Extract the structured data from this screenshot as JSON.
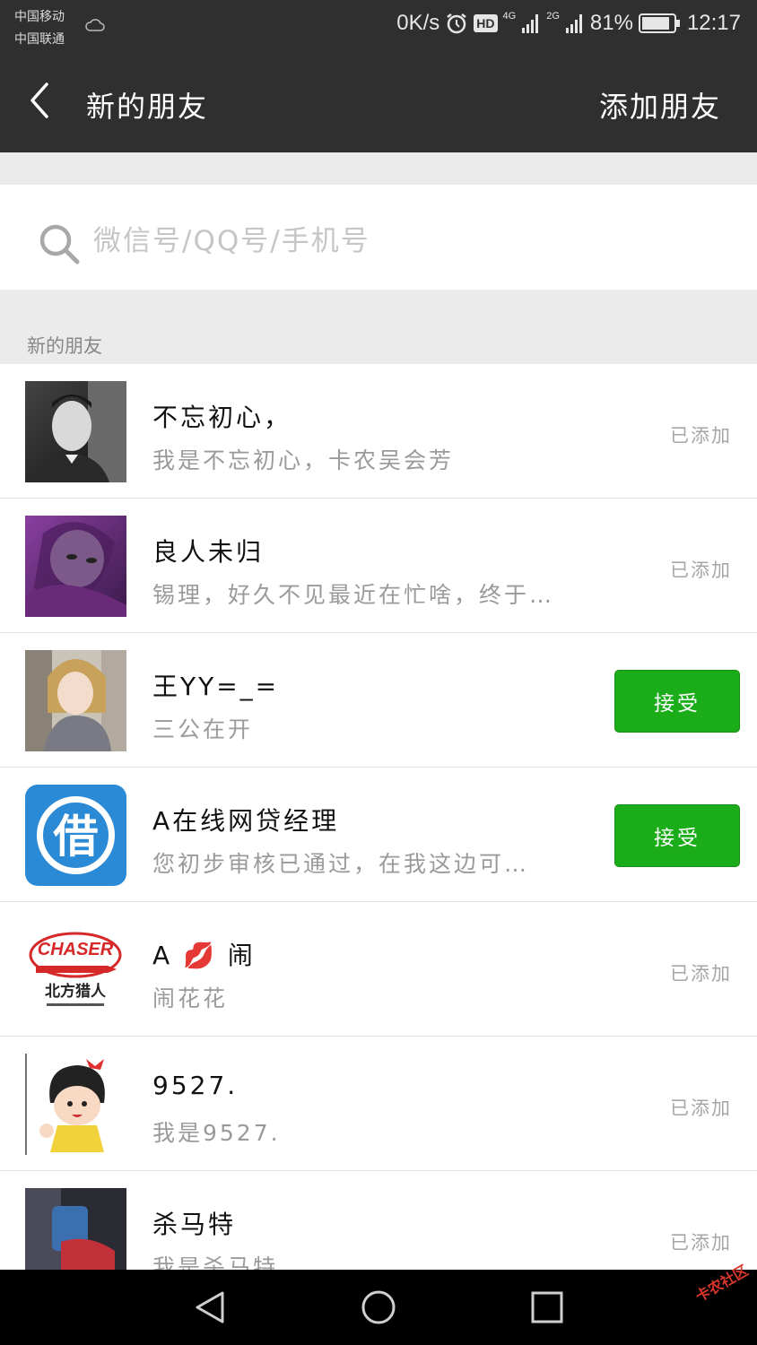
{
  "status_bar": {
    "carrier1": "中国移动",
    "carrier2": "中国联通",
    "speed": "0K/s",
    "hd": "HD",
    "net1": "4G",
    "net2": "2G",
    "battery": "81%",
    "time": "12:17"
  },
  "header": {
    "title": "新的朋友",
    "action": "添加朋友"
  },
  "search": {
    "placeholder": "微信号/QQ号/手机号"
  },
  "section_label": "新的朋友",
  "requests": [
    {
      "name": "不忘初心，",
      "message": "我是不忘初心，卡农吴会芳",
      "status": "已添加",
      "avatar": "avatar-man"
    },
    {
      "name": "良人未归",
      "message": "锡理，好久不见最近在忙啥，终于…",
      "status": "已添加",
      "avatar": "avatar-girl-purple"
    },
    {
      "name": "王YY=_=",
      "message": "三公在开",
      "status": "接受",
      "avatar": "avatar-girl-photo"
    },
    {
      "name": "A在线网贷经理",
      "message": "您初步审核已通过，在我这边可…",
      "status": "接受",
      "avatar": "avatar-jie-logo"
    },
    {
      "name": "A 💋 闹",
      "message": "闹花花",
      "status": "已添加",
      "avatar": "avatar-chaser-logo",
      "logo_text": "CHASER",
      "logo_sub": "北方猎人"
    },
    {
      "name": "9527.",
      "message": "我是9527.",
      "status": "已添加",
      "avatar": "avatar-cartoon-girl"
    },
    {
      "name": "杀马特",
      "message": "我是杀马特",
      "status": "已添加",
      "avatar": "avatar-selfie"
    }
  ],
  "accept_color": "#1aad19",
  "watermark": "卡农社区"
}
